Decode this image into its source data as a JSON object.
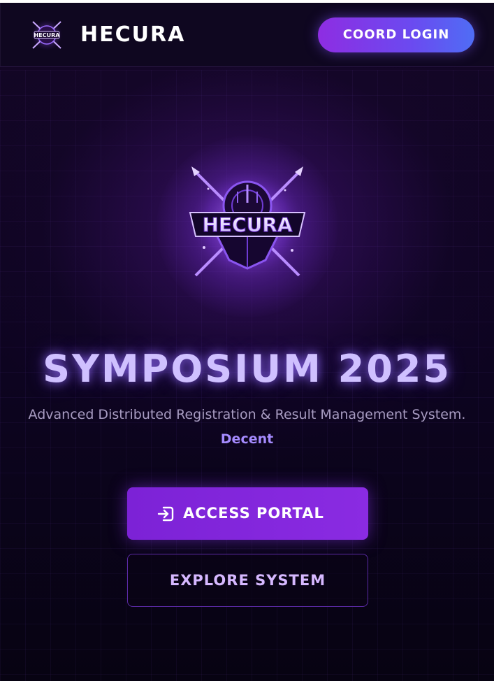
{
  "navbar": {
    "brand_name": "HECURA",
    "login_label": "COORD LOGIN",
    "logo_icon": "hecura-emblem-icon"
  },
  "hero": {
    "emblem_text": "HECURA",
    "emblem_icon": "hecura-emblem-icon",
    "title": "SYMPOSIUM 2025",
    "subtitle": "Advanced Distributed Registration & Result Management System.",
    "tagline": "Decent",
    "primary_button": {
      "label": "ACCESS PORTAL",
      "icon": "login-arrow-icon"
    },
    "secondary_button": {
      "label": "EXPLORE SYSTEM"
    }
  },
  "colors": {
    "background": "#0a0416",
    "accent_purple": "#8a2be2",
    "accent_blue": "#4f6df5",
    "title_glow": "#cfc0ff",
    "tagline": "#a58bff"
  }
}
